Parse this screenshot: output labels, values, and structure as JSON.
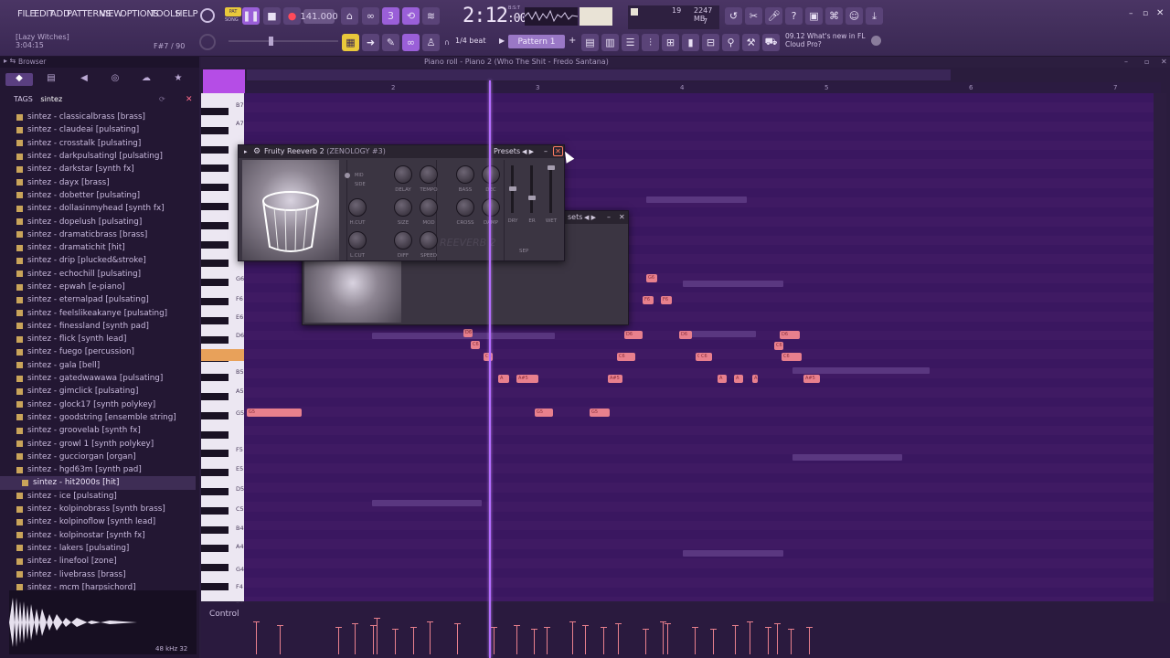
{
  "menu": [
    "FILE",
    "EDIT",
    "ADD",
    "PATTERNS",
    "VIEW",
    "OPTIONS",
    "TOOLS",
    "HELP"
  ],
  "transport": {
    "tempo": "141.000",
    "time": "2:12",
    "time_sub": ":00",
    "pattern": "Pattern 1",
    "snap": "1/4 beat",
    "cpu_voices": "19",
    "ram": "2247 MB",
    "cpu_count": "7",
    "mode": "PAT",
    "mode_alt": "SONG",
    "time_label": "B:S:T"
  },
  "hint": {
    "line1": "[Lazy Witches]",
    "line2": "3:04:15",
    "line3": "F#7 / 90"
  },
  "news": {
    "line1": "09.12  What's new in FL",
    "line2": "Cloud Pro?"
  },
  "browser": {
    "title": "Browser",
    "tags_label": "TAGS",
    "tag_value": "sintez",
    "items": [
      "sintez - classicalbrass [brass]",
      "sintez - claudeai [pulsating]",
      "sintez - crosstalk [pulsating]",
      "sintez - darkpulsatingl [pulsating]",
      "sintez - darkstar [synth fx]",
      "sintez - dayx [brass]",
      "sintez - dobetter [pulsating]",
      "sintez - dollasinmyhead [synth fx]",
      "sintez - dopelush [pulsating]",
      "sintez - dramaticbrass [brass]",
      "sintez - dramatichit [hit]",
      "sintez - drip [plucked&stroke]",
      "sintez - echochill [pulsating]",
      "sintez - epwah [e-piano]",
      "sintez - eternalpad [pulsating]",
      "sintez - feelslikeakanye [pulsating]",
      "sintez - finessland [synth pad]",
      "sintez - flick [synth lead]",
      "sintez - fuego [percussion]",
      "sintez - gala [bell]",
      "sintez - gatedwawawa [pulsating]",
      "sintez - gimclick [pulsating]",
      "sintez - glock17 [synth polykey]",
      "sintez - goodstring [ensemble string]",
      "sintez - groovelab [synth fx]",
      "sintez - growl 1 [synth polykey]",
      "sintez - gucciorgan [organ]",
      "sintez - hgd63m [synth pad]",
      "sintez - hit2000s [hit]",
      "sintez - ice [pulsating]",
      "sintez - kolpinobrass [synth brass]",
      "sintez - kolpinoflow [synth lead]",
      "sintez - kolpinostar [synth fx]",
      "sintez - lakers [pulsating]",
      "sintez - linefool [zone]",
      "sintez - livebrass [brass]",
      "sintez - mcm [harpsichord]"
    ],
    "selected_index": 28,
    "preview_info": "48 kHz 32"
  },
  "pianoroll": {
    "title": "Piano roll - Piano 2 (Who The Shit - Fredo Santana)",
    "ruler": [
      "2",
      "3",
      "4",
      "5",
      "6",
      "7"
    ],
    "key_labels": [
      "B7",
      "A7",
      "G6",
      "F6",
      "E6",
      "D6",
      "C6",
      "B5",
      "A5",
      "G5",
      "F5",
      "E5",
      "D5",
      "C5",
      "B4",
      "A4",
      "G4",
      "F4",
      "E4"
    ],
    "control_label": "Control",
    "notes": [
      {
        "label": "G5"
      },
      {
        "label": "D6"
      },
      {
        "label": "C6"
      },
      {
        "label": "C6"
      },
      {
        "label": "A"
      },
      {
        "label": "A#5"
      },
      {
        "label": "G5"
      },
      {
        "label": "G5"
      },
      {
        "label": "D6"
      },
      {
        "label": "A#5"
      },
      {
        "label": "C6"
      },
      {
        "label": "D6"
      },
      {
        "label": "C6"
      },
      {
        "label": "A"
      },
      {
        "label": "A"
      },
      {
        "label": "A"
      },
      {
        "label": "C6"
      },
      {
        "label": "D6"
      },
      {
        "label": "C6"
      },
      {
        "label": "A#5"
      },
      {
        "label": "G6"
      },
      {
        "label": "F6"
      },
      {
        "label": "F6"
      },
      {
        "label": "C6"
      }
    ]
  },
  "reverb": {
    "title": "Fruity Reeverb 2",
    "preset": "(ZENOLOGY #3)",
    "presets_label": "Presets",
    "second_label": "sets",
    "knobs": [
      "DELAY",
      "TEMPO",
      "BASS",
      "DEC",
      "H.CUT",
      "SIZE",
      "MOD",
      "CROSS",
      "DAMP",
      "L.CUT",
      "DIFF",
      "SPEED"
    ],
    "faders": [
      "DRY",
      "ER",
      "WET"
    ],
    "sep": "SEP",
    "mid": "MID",
    "side": "SIDE",
    "logo": "REEVERB 2"
  }
}
